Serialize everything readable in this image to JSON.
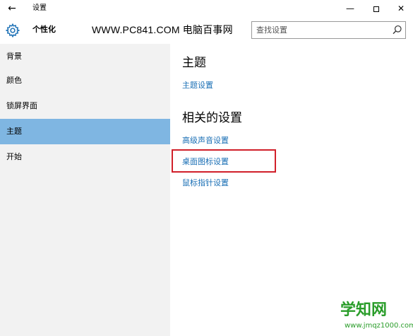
{
  "window": {
    "back_glyph": "←",
    "title": "设置",
    "minimize_glyph": "—",
    "close_glyph": "✕"
  },
  "header": {
    "icon": "gear-icon",
    "title": "个性化",
    "watermark": "WWW.PC841.COM 电脑百事网"
  },
  "search": {
    "placeholder": "查找设置",
    "icon": "search-icon"
  },
  "sidebar": {
    "items": [
      {
        "label": "背景",
        "active": false
      },
      {
        "label": "颜色",
        "active": false
      },
      {
        "label": "锁屏界面",
        "active": false
      },
      {
        "label": "主题",
        "active": true
      },
      {
        "label": "开始",
        "active": false
      }
    ]
  },
  "main": {
    "section1": {
      "title": "主题",
      "links": [
        "主题设置"
      ]
    },
    "section2": {
      "title": "相关的设置",
      "links": [
        "高级声音设置",
        "桌面图标设置",
        "鼠标指针设置"
      ]
    }
  },
  "logo": {
    "text": "学知网",
    "url": "www.jmqz1000.com"
  },
  "colors": {
    "accent": "#7fb6e2",
    "link": "#1a6fb5",
    "highlight": "#d1202a",
    "sidebar_bg": "#f2f2f2",
    "logo_green": "#2a9d2a"
  }
}
